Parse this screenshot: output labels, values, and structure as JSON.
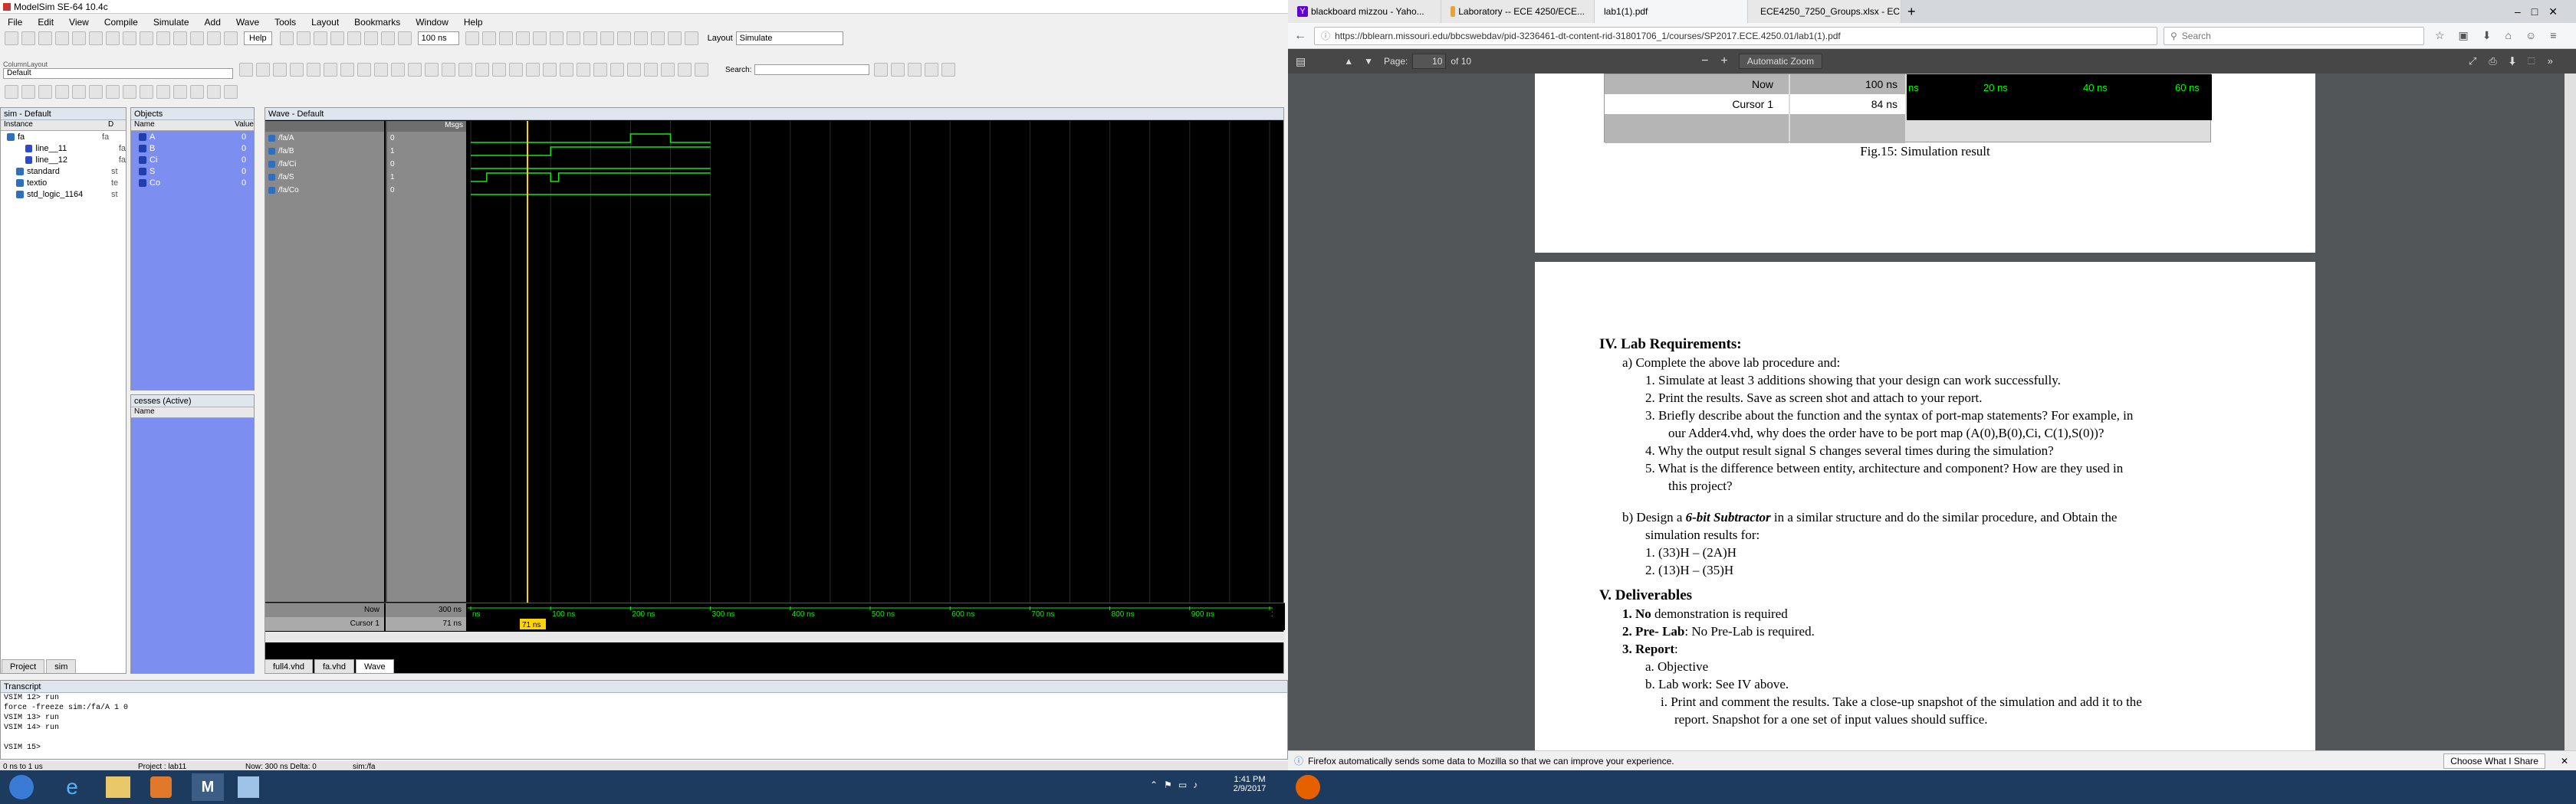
{
  "modelsim": {
    "title": "ModelSim SE-64 10.4c",
    "menu": [
      "File",
      "Edit",
      "View",
      "Compile",
      "Simulate",
      "Add",
      "Wave",
      "Tools",
      "Layout",
      "Bookmarks",
      "Window",
      "Help"
    ],
    "help_label": "Help",
    "run_length": "100 ns",
    "layout_label": "Layout",
    "layout_value": "Simulate",
    "column_layout_label": "ColumnLayout",
    "column_layout_value": "Default",
    "search_label": "Search:",
    "sim_panel": {
      "title": "sim - Default",
      "col": "Instance",
      "col2": "D",
      "items": [
        {
          "label": "fa",
          "type": "fa",
          "indent": 0
        },
        {
          "label": "line__11",
          "type": "fa",
          "indent": 2
        },
        {
          "label": "line__12",
          "type": "fa",
          "indent": 2
        },
        {
          "label": "standard",
          "type": "st",
          "indent": 1
        },
        {
          "label": "textio",
          "type": "te",
          "indent": 1
        },
        {
          "label": "std_logic_1164",
          "type": "st",
          "indent": 1
        }
      ]
    },
    "objects_panel": {
      "title": "Objects",
      "col": "Name",
      "col2": "Value",
      "items": [
        {
          "name": "A",
          "value": "0"
        },
        {
          "name": "B",
          "value": "0"
        },
        {
          "name": "Ci",
          "value": "0"
        },
        {
          "name": "S",
          "value": "0"
        },
        {
          "name": "Co",
          "value": "0"
        }
      ]
    },
    "processes_panel": {
      "title": "cesses (Active)",
      "col": "Name"
    },
    "wave": {
      "title": "Wave - Default",
      "msgs": "Msgs",
      "signals": [
        {
          "name": "/fa/A",
          "value": "0"
        },
        {
          "name": "/fa/B",
          "value": "1"
        },
        {
          "name": "/fa/Ci",
          "value": "0"
        },
        {
          "name": "/fa/S",
          "value": "1"
        },
        {
          "name": "/fa/Co",
          "value": "0"
        }
      ],
      "now_label": "Now",
      "now_value": "300 ns",
      "cursor_label": "Cursor 1",
      "cursor_value": "71 ns",
      "cursor_flag": "71 ns",
      "ticks": [
        "ns",
        "100 ns",
        "200 ns",
        "300 ns",
        "400 ns",
        "500 ns",
        "600 ns",
        "700 ns",
        "800 ns",
        "900 ns",
        "100"
      ],
      "time_end_ns": 1000,
      "cursor_ns": 71,
      "waves": [
        {
          "name": "A",
          "transitions": [
            [
              0,
              0
            ],
            [
              100,
              0
            ],
            [
              200,
              1
            ],
            [
              250,
              0
            ],
            [
              300,
              0
            ]
          ]
        },
        {
          "name": "B",
          "transitions": [
            [
              0,
              0
            ],
            [
              100,
              1
            ],
            [
              200,
              1
            ],
            [
              250,
              1
            ],
            [
              300,
              1
            ]
          ]
        },
        {
          "name": "Ci",
          "transitions": [
            [
              0,
              0
            ],
            [
              100,
              0
            ],
            [
              200,
              0
            ],
            [
              250,
              0
            ],
            [
              300,
              0
            ]
          ]
        },
        {
          "name": "S",
          "transitions": [
            [
              0,
              0
            ],
            [
              20,
              1
            ],
            [
              100,
              0
            ],
            [
              110,
              1
            ],
            [
              300,
              1
            ]
          ]
        },
        {
          "name": "Co",
          "transitions": [
            [
              0,
              0
            ],
            [
              300,
              0
            ]
          ]
        }
      ]
    },
    "bottom_tabs": [
      "Project",
      "sim"
    ],
    "file_tabs": [
      "full4.vhd",
      "fa.vhd",
      "Wave"
    ],
    "transcript": {
      "title": "Transcript",
      "lines": [
        "VSIM 12> run",
        "force -freeze sim:/fa/A 1 0",
        "VSIM 13> run",
        "VSIM 14> run",
        "",
        "VSIM 15>"
      ]
    },
    "status": {
      "range": "0 ns to 1 us",
      "project": "Project : lab11",
      "now": "Now: 300 ns  Delta: 0",
      "path": "sim:/fa"
    }
  },
  "firefox": {
    "tabs": [
      {
        "label": "blackboard mizzou - Yaho..."
      },
      {
        "label": "Laboratory -- ECE 4250/ECE..."
      },
      {
        "label": "lab1(1).pdf"
      },
      {
        "label": "ECE4250_7250_Groups.xlsx - EC..."
      }
    ],
    "url": "https://bblearn.missouri.edu/bbcswebdav/pid-3236461-dt-content-rid-31801706_1/courses/SP2017.ECE.4250.01/lab1(1).pdf",
    "search_placeholder": "Search",
    "pdf_toolbar": {
      "page_label": "Page:",
      "page": "10",
      "of": "of 10",
      "zoom": "Automatic Zoom"
    },
    "embedded": {
      "now_label": "Now",
      "now_value": "100 ns",
      "cursor_label": "Cursor 1",
      "cursor_value": "84 ns",
      "ticks": [
        "ns",
        "20 ns",
        "40 ns",
        "60 ns"
      ]
    },
    "fig_caption": "Fig.15: Simulation result",
    "sec4_title": "IV. Lab Requirements:",
    "a_line": "a)   Complete the above lab procedure and:",
    "a_items": [
      "1.   Simulate at least 3 additions showing that your design can work successfully.",
      "2.   Print the results. Save as screen shot and attach to your report.",
      "3.   Briefly describe about the function and the syntax of port-map statements? For example, in",
      "our Adder4.vhd, why does the order have to be port map (A(0),B(0),Ci, C(1),S(0))?",
      "4.   Why the output result signal S changes several times during the simulation?",
      "5.   What is the difference between entity, architecture and component? How are they used in",
      "this project?"
    ],
    "b_line_1": "b)   Design a ",
    "b_bold": "6-bit Subtractor",
    "b_line_2": " in a similar structure and do the similar procedure, and Obtain the",
    "b_line_3": "simulation results for:",
    "b_items": [
      "1.   (33)H – (2A)H",
      "2.   (13)H – (35)H"
    ],
    "sec5_title": "V. Deliverables",
    "d1_bold": "1. No",
    "d1": " demonstration is required",
    "d2_bold": "2. Pre- Lab",
    "d2": ": No Pre-Lab is required.",
    "d3_bold": "3. Report",
    "d3": ":",
    "d3a": "a. Objective",
    "d3b": "b. Lab work: See IV above.",
    "d3bi": "i.  Print and comment the results. Take a close-up snapshot of the simulation and add it to the",
    "d3bi2": "report. Snapshot for a one set of input values should suffice.",
    "notice": "Firefox automatically sends some data to Mozilla so that we can improve your experience.",
    "notice_button": "Choose What I Share"
  },
  "taskbar": {
    "time": "1:41 PM",
    "date": "2/9/2017"
  }
}
